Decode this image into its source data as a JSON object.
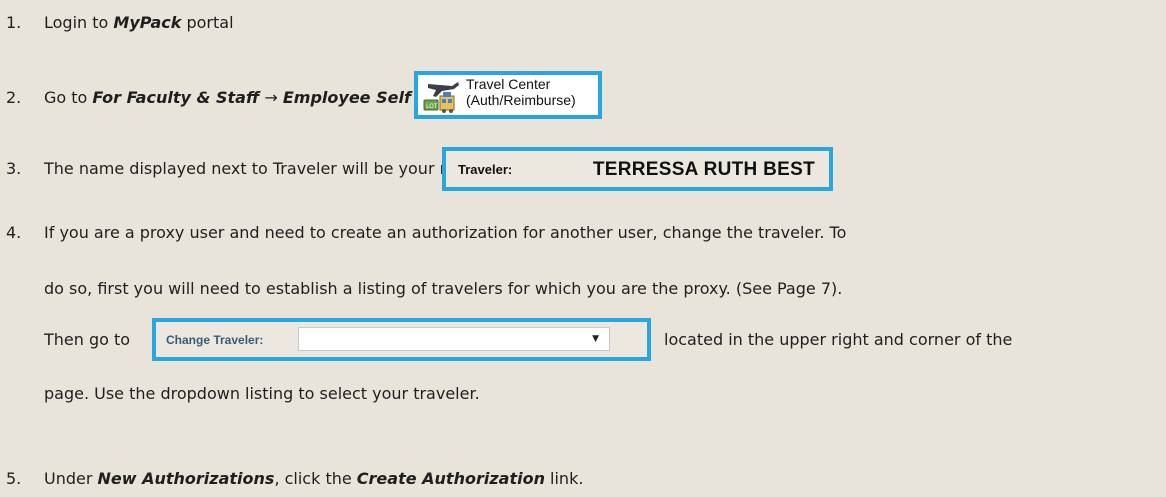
{
  "steps": [
    {
      "num": "1.",
      "pre": "Login to ",
      "em": "MyPack",
      "post": " portal"
    },
    {
      "num": "2.",
      "pre": "Go to ",
      "em1": "For Faculty & Staff",
      "arrow1": " → ",
      "em2": "Employee Self Service",
      "arrow2": " →"
    },
    {
      "num": "3.",
      "text": "The name displayed next to Traveler will be your name."
    },
    {
      "num": "4.",
      "line1": "If you are a proxy user and need to create an authorization for another user, change the traveler.  To",
      "line2": "do so, first you will need to establish a listing of  travelers for which you are the proxy.  (See Page 7).",
      "line3_pre": "Then go to",
      "line3_post": "located in the upper right and corner of the",
      "line4": "page.  Use the dropdown listing to select your traveler."
    },
    {
      "num": "5.",
      "pre": "Under ",
      "em1": "New Authorizations",
      "mid": ", click the ",
      "em2": "Create Authorization",
      "post": " link."
    }
  ],
  "travel_center": {
    "line1": "Travel Center",
    "line2": "(Auth/Reimburse)",
    "icon": "airplane-suitcase-icon"
  },
  "traveler": {
    "label": "Traveler:",
    "name": "TERRESSA RUTH BEST"
  },
  "change_traveler": {
    "label": "Change Traveler:",
    "value": "",
    "caret_icon": "chevron-down-icon"
  },
  "colors": {
    "highlight_border": "#27a6e0",
    "background": "#e9e4da"
  }
}
